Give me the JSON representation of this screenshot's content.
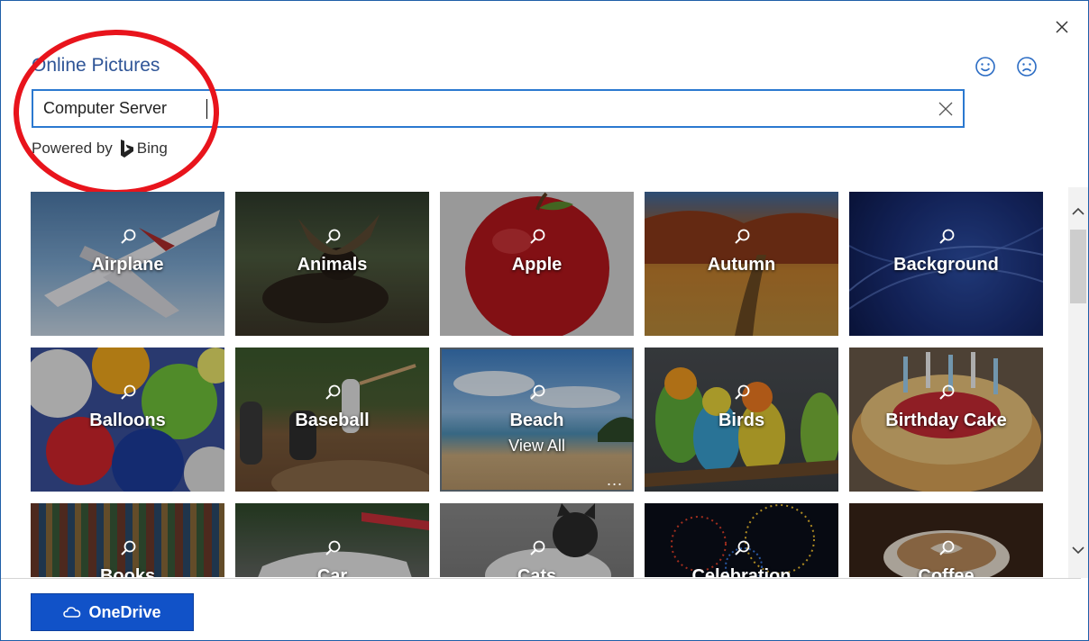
{
  "dialog": {
    "title": "Online Pictures",
    "close_icon": "close-icon",
    "feedback": {
      "happy_icon": "smile-icon",
      "sad_icon": "frown-icon"
    }
  },
  "search": {
    "value": "Computer Server",
    "placeholder": "",
    "clear_icon": "clear-icon"
  },
  "powered_by": {
    "prefix": "Powered by",
    "brand": "Bing"
  },
  "tiles": [
    {
      "label": "Airplane"
    },
    {
      "label": "Animals"
    },
    {
      "label": "Apple"
    },
    {
      "label": "Autumn"
    },
    {
      "label": "Background"
    },
    {
      "label": "Balloons"
    },
    {
      "label": "Baseball"
    },
    {
      "label": "Beach",
      "sublabel": "View All",
      "more": "..."
    },
    {
      "label": "Birds"
    },
    {
      "label": "Birthday Cake"
    },
    {
      "label": "Books"
    },
    {
      "label": "Car"
    },
    {
      "label": "Cats"
    },
    {
      "label": "Celebration"
    },
    {
      "label": "Coffee"
    }
  ],
  "footer": {
    "onedrive_label": "OneDrive"
  },
  "colors": {
    "accent": "#2b79d0",
    "title": "#2f5597",
    "button": "#1152c8",
    "annotation": "#e8141c"
  }
}
